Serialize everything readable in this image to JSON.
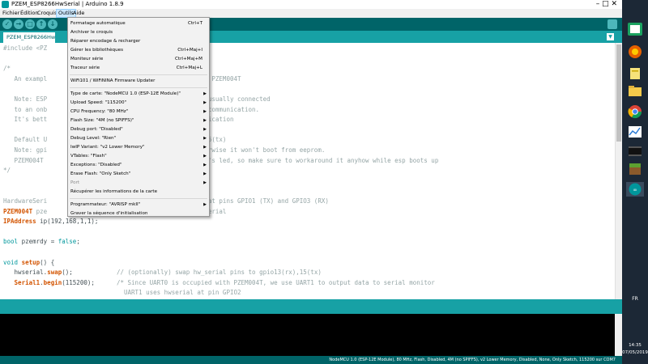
{
  "window": {
    "title": "PZEM_ESP8266HwSerial | Arduino 1.8.9",
    "controls": "–  □  ✕"
  },
  "menubar": {
    "items": [
      {
        "label": "Fichier"
      },
      {
        "label": "Édition"
      },
      {
        "label": "Croquis"
      },
      {
        "label": "Outils"
      },
      {
        "label": "Aide"
      }
    ]
  },
  "toolbar": {
    "buttons": [
      {
        "name": "verify-button",
        "glyph": "✓"
      },
      {
        "name": "upload-button",
        "glyph": "→"
      },
      {
        "name": "new-button",
        "glyph": "□"
      },
      {
        "name": "open-button",
        "glyph": "↑"
      },
      {
        "name": "save-button",
        "glyph": "↓"
      }
    ]
  },
  "tab": {
    "label": "PZEM_ESP8266HwSerial",
    "menu_glyph": "▼"
  },
  "tools_menu": {
    "items": [
      {
        "label": "Formatage automatique",
        "shortcut": "Ctrl+T",
        "arrow": false,
        "disabled": false
      },
      {
        "label": "Archiver le croquis",
        "shortcut": "",
        "arrow": false,
        "disabled": false
      },
      {
        "label": "Réparer encodage & recharger",
        "shortcut": "",
        "arrow": false,
        "disabled": false
      },
      {
        "label": "Gérer les bibliothèques",
        "shortcut": "Ctrl+Maj+I",
        "arrow": false,
        "disabled": false
      },
      {
        "label": "Moniteur série",
        "shortcut": "Ctrl+Maj+M",
        "arrow": false,
        "disabled": false
      },
      {
        "label": "Traceur série",
        "shortcut": "Ctrl+Maj+L",
        "arrow": false,
        "disabled": false
      },
      {
        "sep": true
      },
      {
        "label": "WiFi101 / WiFiNINA Firmware Updater",
        "shortcut": "",
        "arrow": false,
        "disabled": false
      },
      {
        "sep": true
      },
      {
        "label": "Type de carte: \"NodeMCU 1.0 (ESP-12E Module)\"",
        "shortcut": "",
        "arrow": true,
        "disabled": false
      },
      {
        "label": "Upload Speed: \"115200\"",
        "shortcut": "",
        "arrow": true,
        "disabled": false
      },
      {
        "label": "CPU Frequency: \"80 MHz\"",
        "shortcut": "",
        "arrow": true,
        "disabled": false
      },
      {
        "label": "Flash Size: \"4M (no SPIFFS)\"",
        "shortcut": "",
        "arrow": true,
        "disabled": false
      },
      {
        "label": "Debug port: \"Disabled\"",
        "shortcut": "",
        "arrow": true,
        "disabled": false
      },
      {
        "label": "Debug Level: \"Rien\"",
        "shortcut": "",
        "arrow": true,
        "disabled": false
      },
      {
        "label": "IwIP Variant: \"v2 Lower Memory\"",
        "shortcut": "",
        "arrow": true,
        "disabled": false
      },
      {
        "label": "VTables: \"Flash\"",
        "shortcut": "",
        "arrow": true,
        "disabled": false
      },
      {
        "label": "Exceptions: \"Disabled\"",
        "shortcut": "",
        "arrow": true,
        "disabled": false
      },
      {
        "label": "Erase Flash: \"Only Sketch\"",
        "shortcut": "",
        "arrow": true,
        "disabled": false
      },
      {
        "label": "Port",
        "shortcut": "",
        "arrow": true,
        "disabled": true
      },
      {
        "label": "Récupérer les informations de la carte",
        "shortcut": "",
        "arrow": false,
        "disabled": false
      },
      {
        "sep": true
      },
      {
        "label": "Programmateur: \"AVRISP mkII\"",
        "shortcut": "",
        "arrow": true,
        "disabled": false
      },
      {
        "label": "Graver la séquence d'initialisation",
        "shortcut": "",
        "arrow": false,
        "disabled": false
      }
    ]
  },
  "editor": {
    "lines": [
      [
        {
          "t": "#include <PZ",
          "c": "pp"
        }
      ],
      [],
      [
        {
          "t": "/*",
          "c": "cm"
        }
      ],
      [
        {
          "t": "   An exampl                                 serial with PZEM004T",
          "c": "cm"
        }
      ],
      [],
      [
        {
          "t": "   Note: ESP                                 3 (RX) are usually connected",
          "c": "cm"
        }
      ],
      [
        {
          "t": "   to an onb                                 ffect PZEM communication.",
          "c": "cm"
        }
      ],
      [
        {
          "t": "   It's bett                                 PZEM communication",
          "c": "cm"
        }
      ],
      [],
      [
        {
          "t": "   Default U                                 3(rx),gpio15(tx)",
          "c": "cm"
        }
      ],
      [
        {
          "t": "   Note: gpi                                 start, otherwise it won't boot from eeprom.",
          "c": "cm"
        }
      ],
      [
        {
          "t": "   PZEM004T                                  optocoupler's led, so make sure to workaround it anyhow while esp boots up",
          "c": "cm"
        }
      ],
      [
        {
          "t": "*/",
          "c": "cm"
        }
      ],
      [],
      [],
      [
        {
          "t": "HardwareSeri                                 rial UART0 at pins GPIO1 (TX) and GPIO3 (RX)",
          "c": "cm"
        }
      ],
      [
        {
          "t": "PZEM004T",
          "c": "ty"
        },
        {
          "t": " pze                                 PZEM to hwserial",
          "c": "cm"
        }
      ],
      [
        {
          "t": "IPAddress",
          "c": "ty"
        },
        {
          "t": " ip(192,168,1,1);",
          "c": "tx"
        }
      ],
      [],
      [
        {
          "t": "bool",
          "c": "kw"
        },
        {
          "t": " pzemrdy = ",
          "c": "tx"
        },
        {
          "t": "false",
          "c": "kw"
        },
        {
          "t": ";",
          "c": "tx"
        }
      ],
      [],
      [
        {
          "t": "void",
          "c": "kw"
        },
        {
          "t": " ",
          "c": "tx"
        },
        {
          "t": "setup",
          "c": "ty"
        },
        {
          "t": "() {",
          "c": "tx"
        }
      ],
      [
        {
          "t": "   hwserial.",
          "c": "tx"
        },
        {
          "t": "swap",
          "c": "ty"
        },
        {
          "t": "();            ",
          "c": "tx"
        },
        {
          "t": "// (optionally) swap hw_serial pins to gpio13(rx),15(tx)",
          "c": "cm"
        }
      ],
      [
        {
          "t": "   ",
          "c": "tx"
        },
        {
          "t": "Serial1",
          "c": "ty"
        },
        {
          "t": ".",
          "c": "tx"
        },
        {
          "t": "begin",
          "c": "ty"
        },
        {
          "t": "(115200);      ",
          "c": "tx"
        },
        {
          "t": "/* Since UART0 is occupied with PZEM004T, we use UART1 to output data to serial monitor",
          "c": "cm"
        }
      ],
      [
        {
          "t": "                                 UART1 uses hwserial at pin GPIO2",
          "c": "cm"
        }
      ]
    ]
  },
  "statusbar": {
    "board_info": "NodeMCU 1.0 (ESP-12E Module), 80 MHz, Flash, Disabled, 4M (no SPIFFS), v2 Lower Memory, Disabled, None, Only Sketch, 115200 sur COM7"
  },
  "taskbar": {
    "icons": [
      "edge-icon",
      "firefox-icon",
      "files-icon",
      "file-explorer-icon",
      "chrome-icon",
      "chart-app-icon",
      "video-app-icon",
      "minecraft-icon",
      "arduino-icon"
    ],
    "active_icon": "arduino-icon",
    "lang": "FR",
    "time": "14:35",
    "date": "07/05/2019"
  },
  "colors": {
    "arduino_teal_dark": "#006468",
    "arduino_teal": "#17a1a5",
    "keyword": "#00979c",
    "type": "#d35400",
    "comment": "#95a5a6",
    "taskbar": "#1c2836"
  }
}
